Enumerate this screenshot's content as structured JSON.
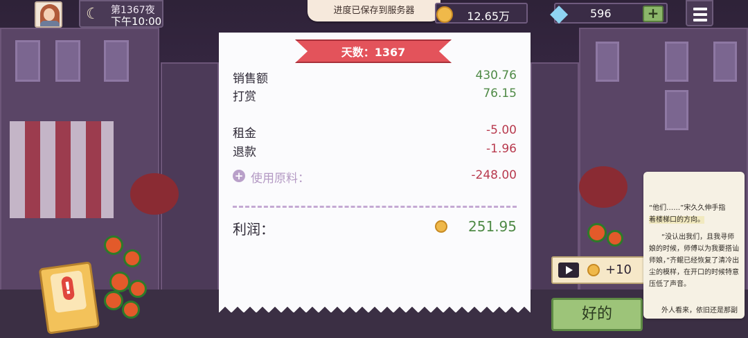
{
  "header": {
    "day_label": "第1367夜",
    "time_label": "下午10:00",
    "toast": "进度已保存到服务器",
    "coins": "12.65万",
    "gems": "596",
    "gem_add": "+"
  },
  "receipt": {
    "ribbon": "天数：1367",
    "sales": {
      "label": "销售额",
      "value": "430.76"
    },
    "tips": {
      "label": "打赏",
      "value": "76.15"
    },
    "rent": {
      "label": "租金",
      "value": "-5.00"
    },
    "refund": {
      "label": "退款",
      "value": "-1.96"
    },
    "materials": {
      "label": "使用原料：",
      "value": "-248.00"
    },
    "profit": {
      "label": "利润：",
      "value": "251.95"
    }
  },
  "actions": {
    "ad_reward": "+10",
    "ok": "好的",
    "alert_mark": "!"
  },
  "novel": {
    "para1_a": "“他们……”宋久久伸手指",
    "para1_b": "着楼梯口的方向。",
    "para2": "“没认出我们，且我寻师娘的时候，师傅以为我要搭讪师娘，”齐鲲已经恢复了清冷出尘的模样，在开口的时候特意压低了声音。",
    "para3": "外人看来，依旧还是那副"
  },
  "colors": {
    "profit_green": "#4f8a46",
    "loss_red": "#b83a4e",
    "ribbon_red": "#e3535b",
    "ok_green": "#9dc479"
  }
}
